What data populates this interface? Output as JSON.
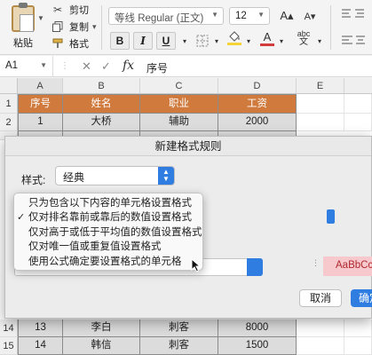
{
  "ribbon": {
    "paste_label": "粘贴",
    "cut_label": "剪切",
    "copy_label": "复制",
    "copy_dropdown": "▾",
    "format_label": "格式",
    "font_name": "等线 Regular (正文)",
    "font_size": "12",
    "grow_font": "A▴",
    "shrink_font": "A▾",
    "bold": "B",
    "italic": "I",
    "underline": "U",
    "font_color_letter": "A",
    "phonetic_label": "abc",
    "accent_color": "#d23c3c",
    "highlight_color": "#f5d33b"
  },
  "formula_bar": {
    "cell_ref": "A1",
    "cancel_icon": "✕",
    "confirm_icon": "✓",
    "fx_label": "fx",
    "content": "序号"
  },
  "grid": {
    "columns": [
      "A",
      "B",
      "C",
      "D",
      "E"
    ],
    "rows_top": [
      "1",
      "2"
    ],
    "rows_bottom": [
      "14",
      "15",
      "16"
    ],
    "header_row": [
      "序号",
      "姓名",
      "职业",
      "工资"
    ],
    "row2": [
      "1",
      "大桥",
      "辅助",
      "2000"
    ],
    "row14": [
      "13",
      "李白",
      "刺客",
      "8000"
    ],
    "row15": [
      "14",
      "韩信",
      "刺客",
      "1500"
    ],
    "header_color": "#d07a3d"
  },
  "dialog": {
    "title": "新建格式规则",
    "style_label": "样式:",
    "style_value": "经典",
    "preview_text": "AaBbCc",
    "cancel_label": "取消",
    "ok_label": "确定"
  },
  "menu": {
    "items": [
      {
        "label": "只为包含以下内容的单元格设置格式",
        "checked": false
      },
      {
        "label": "仅对排名靠前或靠后的数值设置格式",
        "checked": true
      },
      {
        "label": "仅对高于或低于平均值的数值设置格式",
        "checked": false
      },
      {
        "label": "仅对唯一值或重复值设置格式",
        "checked": false
      },
      {
        "label": "使用公式确定要设置格式的单元格",
        "checked": false
      }
    ],
    "check_glyph": "✓"
  }
}
